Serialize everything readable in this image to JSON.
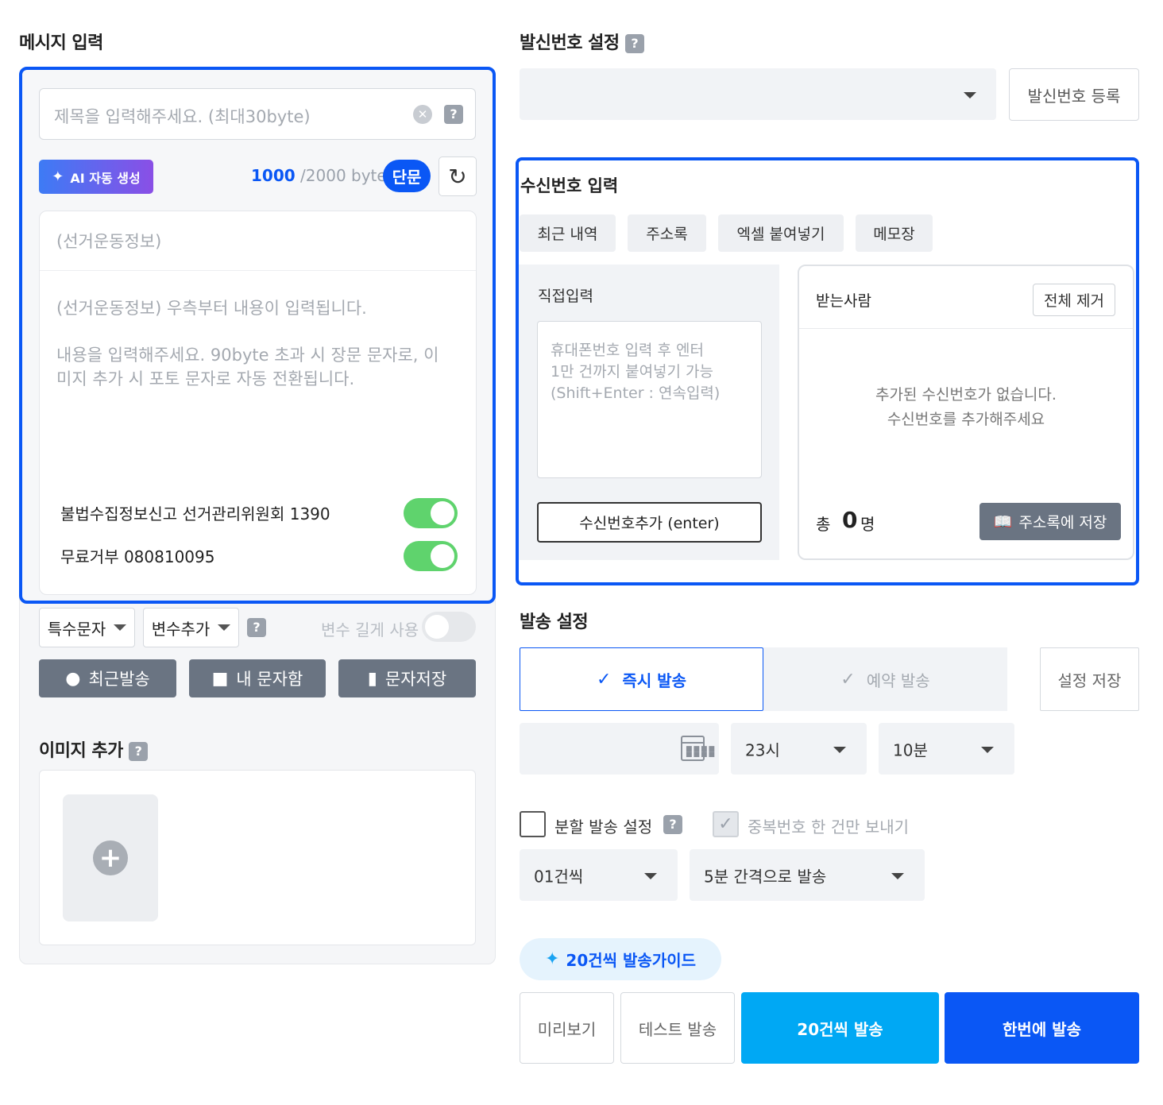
{
  "message": {
    "section_title": "메시지 입력",
    "subject_placeholder": "제목을 입력해주세요. (최대30byte)",
    "help": "?",
    "clear": "✕",
    "ai_button": "AI 자동 생성",
    "byte_current": "1000",
    "byte_max": "/2000 byte",
    "type_badge": "단문",
    "refresh": "↻",
    "body_header": "(선거운동정보)",
    "body_line1": "(선거운동정보) 우측부터 내용이 입력됩니다.",
    "body_line2": "내용을 입력해주세요. 90byte 초과 시 장문 문자로, 이미지 추가 시 포토 문자로 자동 전환됩니다.",
    "toggle1_label": "불법수집정보신고 선거관리위원회 1390",
    "toggle1_on": true,
    "toggle2_label": "무료거부 080810095",
    "toggle2_on": true
  },
  "tools": {
    "special_chars": "특수문자",
    "add_variable": "변수추가",
    "variable_long": "변수 길게 사용",
    "variable_long_on": false,
    "recent_sent": "최근발송",
    "my_messages": "내 문자함",
    "save_message": "문자저장"
  },
  "image": {
    "title": "이미지 추가",
    "add": "+"
  },
  "sender": {
    "title": "발신번호 설정",
    "selected": "",
    "register_button": "발신번호 등록"
  },
  "receiver": {
    "title": "수신번호 입력",
    "tabs": [
      {
        "label": "최근 내역"
      },
      {
        "label": "주소록"
      },
      {
        "label": "엑셀 붙여넣기"
      },
      {
        "label": "메모장"
      }
    ],
    "direct_label": "직접입력",
    "direct_placeholder_1": "휴대폰번호 입력 후 엔터",
    "direct_placeholder_2": "1만 건까지 붙여넣기 가능",
    "direct_placeholder_3": "(Shift+Enter : 연속입력)",
    "add_button": "수신번호추가 (enter)",
    "recipients_label": "받는사람",
    "clear_all": "전체 제거",
    "empty_1": "추가된 수신번호가 없습니다.",
    "empty_2": "수신번호를 추가해주세요",
    "total_label": "총",
    "total_count": "0",
    "total_unit": "명",
    "save_to_address": "주소록에 저장"
  },
  "send": {
    "title": "발송 설정",
    "instant": "즉시 발송",
    "reserve": "예약 발송",
    "save_setting": "설정 저장",
    "date": "",
    "hour": "23시",
    "minute": "10분",
    "split_label": "분할 발송 설정",
    "split_checked": false,
    "dup_label": "중복번호 한 건만 보내기",
    "dup_checked": true,
    "split_count": "01건씩",
    "split_interval": "5분 간격으로 발송",
    "guide": "20건씩 발송가이드",
    "preview": "미리보기",
    "test": "테스트 발송",
    "batch_send": "20건씩 발송",
    "send_once": "한번에 발송"
  },
  "colors": {
    "primary": "#0a57f5",
    "sky": "#00a8f4",
    "toggle_on": "#5fd36d",
    "dark_button": "#6a7482"
  },
  "icons": {
    "ai": "sparkle-icon",
    "refresh": "refresh-icon",
    "recent": "clock-icon",
    "folder": "folder-icon",
    "bookmark": "bookmark-icon",
    "calendar": "calendar-icon",
    "book": "book-icon",
    "guide": "diamond-star-icon"
  }
}
